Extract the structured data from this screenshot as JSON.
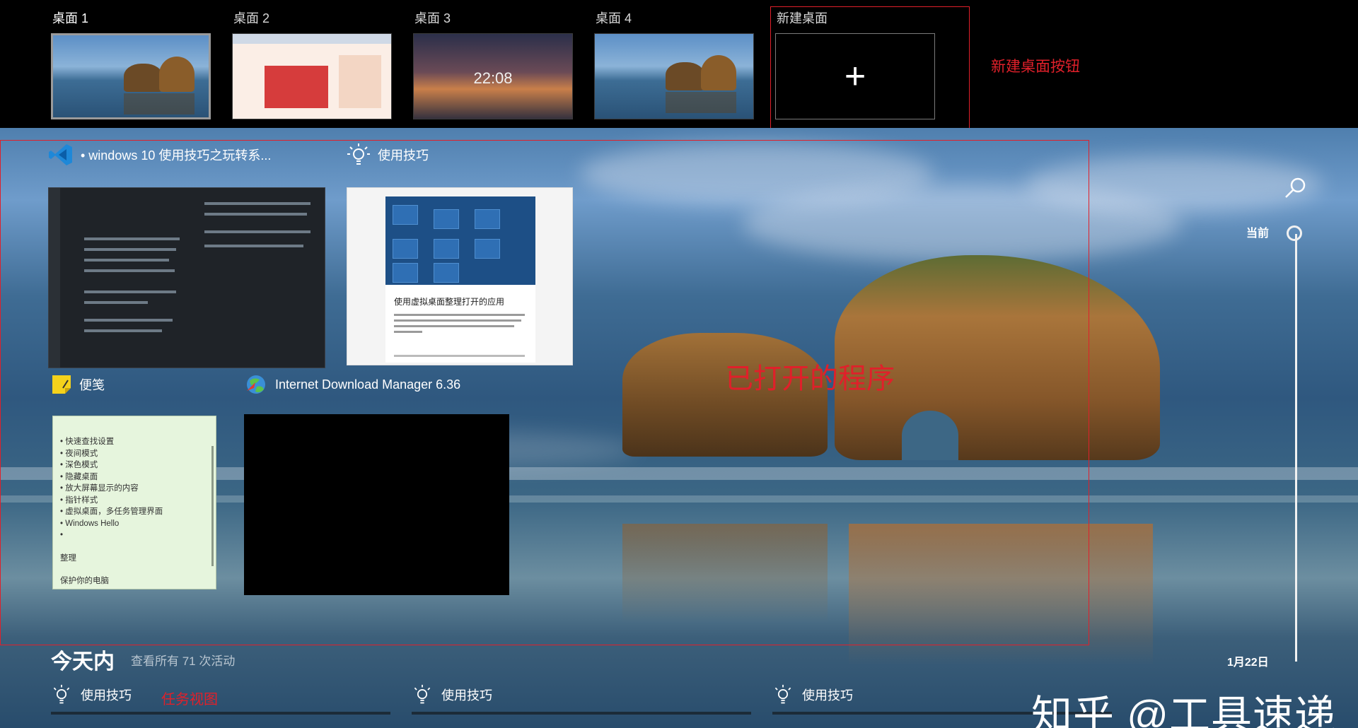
{
  "desktops": [
    {
      "label": "桌面 1",
      "current": true
    },
    {
      "label": "桌面 2",
      "current": false
    },
    {
      "label": "桌面 3",
      "current": false,
      "lock_time": "22:08"
    },
    {
      "label": "桌面 4",
      "current": false
    }
  ],
  "new_desktop": {
    "label": "新建桌面",
    "plus": "+"
  },
  "annotations": {
    "new_desktop_button": "新建桌面按钮",
    "open_programs": "已打开的程序",
    "task_view": "任务视图",
    "color": "#e0202a"
  },
  "windows": {
    "vscode": {
      "title": "• windows 10 使用技巧之玩转系...",
      "icon": "vscode-icon"
    },
    "tips": {
      "title": "使用技巧",
      "icon": "lightbulb-icon",
      "card_heading": "使用虚拟桌面整理打开的应用"
    },
    "sticky": {
      "title": "便笺",
      "icon": "sticky-notes-icon",
      "lines": [
        "• 快速查找设置",
        "• 夜间模式",
        "• 深色模式",
        "• 隐藏桌面",
        "• 放大屏幕显示的内容",
        "• 指针样式",
        "• 虚拟桌面，多任务管理界面",
        "• Windows Hello",
        "•",
        "",
        "整理",
        "",
        "保护你的电脑"
      ]
    },
    "idm": {
      "title": "Internet Download Manager 6.36",
      "icon": "idm-globe-icon"
    }
  },
  "timeline": {
    "now_label": "当前",
    "date_label": "1月22日",
    "search_icon": "search-icon"
  },
  "activity": {
    "heading": "今天内",
    "see_all": "查看所有 71 次活动",
    "items": [
      {
        "title": "使用技巧",
        "icon": "lightbulb-icon"
      },
      {
        "title": "使用技巧",
        "icon": "lightbulb-icon"
      },
      {
        "title": "使用技巧",
        "icon": "lightbulb-icon"
      }
    ]
  },
  "watermark": "知乎 @工具速递"
}
